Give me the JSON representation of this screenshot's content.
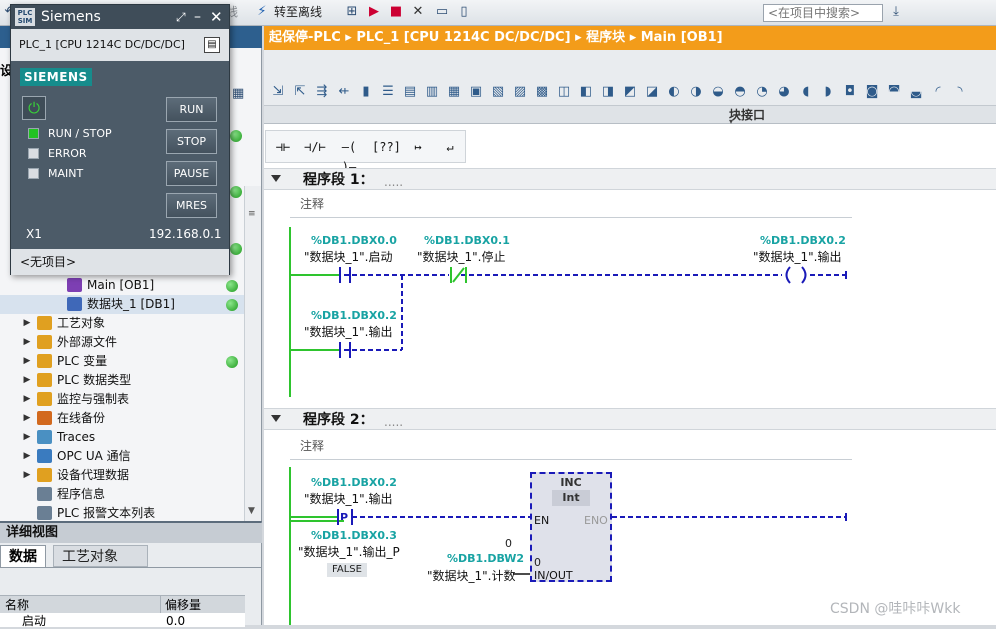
{
  "toolbar": {
    "go_online": "转至在线",
    "go_offline": "转至离线",
    "search_placeholder": "<在项目中搜索>"
  },
  "simulator": {
    "sim_badge_top": "PLC",
    "sim_badge_bottom": "SIM",
    "title": "Siemens",
    "subtitle": "PLC_1 [CPU 1214C DC/DC/DC]",
    "logo": "SIEMENS",
    "buttons": [
      "RUN",
      "STOP",
      "PAUSE",
      "MRES"
    ],
    "leds": [
      {
        "label": "RUN / STOP",
        "color": "#22c222"
      },
      {
        "label": "ERROR",
        "color": "#d9dde2"
      },
      {
        "label": "MAINT",
        "color": "#d9dde2"
      }
    ],
    "port": "X1",
    "ip": "192.168.0.1",
    "footer": "<无项目>"
  },
  "left_panel": {
    "head_partial": "设",
    "tree": [
      {
        "label": "Main [OB1]",
        "level": 3,
        "arrow": false,
        "icon_color": "#7d3fb3",
        "status": true,
        "selected": false
      },
      {
        "label": "数据块_1 [DB1]",
        "level": 3,
        "arrow": false,
        "icon_color": "#3f68b8",
        "status": true,
        "selected": true
      },
      {
        "label": "工艺对象",
        "level": 1,
        "arrow": true,
        "icon_color": "#e0a020",
        "status": false,
        "selected": false
      },
      {
        "label": "外部源文件",
        "level": 1,
        "arrow": true,
        "icon_color": "#e0a020",
        "status": false,
        "selected": false
      },
      {
        "label": "PLC 变量",
        "level": 1,
        "arrow": true,
        "icon_color": "#e0a020",
        "status": true,
        "selected": false
      },
      {
        "label": "PLC 数据类型",
        "level": 1,
        "arrow": true,
        "icon_color": "#e0a020",
        "status": false,
        "selected": false
      },
      {
        "label": "监控与强制表",
        "level": 1,
        "arrow": true,
        "icon_color": "#e0a020",
        "status": false,
        "selected": false
      },
      {
        "label": "在线备份",
        "level": 1,
        "arrow": true,
        "icon_color": "#d2691e",
        "status": false,
        "selected": false
      },
      {
        "label": "Traces",
        "level": 1,
        "arrow": true,
        "icon_color": "#4a90c2",
        "status": false,
        "selected": false
      },
      {
        "label": "OPC UA 通信",
        "level": 1,
        "arrow": true,
        "icon_color": "#3a7bbf",
        "status": false,
        "selected": false
      },
      {
        "label": "设备代理数据",
        "level": 1,
        "arrow": true,
        "icon_color": "#e0a020",
        "status": false,
        "selected": false
      },
      {
        "label": "程序信息",
        "level": 1,
        "arrow": false,
        "icon_color": "#6a7f94",
        "status": false,
        "selected": false
      },
      {
        "label": "PLC 报警文本列表",
        "level": 1,
        "arrow": false,
        "icon_color": "#6a7f94",
        "status": false,
        "selected": false
      }
    ]
  },
  "detail_view": {
    "title": "详细视图",
    "tabs": [
      "数据",
      "工艺对象"
    ],
    "columns": [
      "名称",
      "偏移量"
    ],
    "row": {
      "name": "启动",
      "offset": "0.0"
    }
  },
  "editor": {
    "breadcrumb": [
      "起保停-PLC",
      "PLC_1 [CPU 1214C DC/DC/DC]",
      "程序块",
      "Main [OB1]"
    ],
    "block_interface": "块接口",
    "ladder_elements": [
      "⊣⊢",
      "⊣/⊢",
      "–( )–",
      "[??]",
      "↦",
      "↵"
    ],
    "networks": [
      {
        "title": "程序段 1：",
        "dots": ".....",
        "comment": "注释",
        "vars": [
          {
            "addr": "%DB1.DBX0.0",
            "name": "\"数据块_1\".启动"
          },
          {
            "addr": "%DB1.DBX0.1",
            "name": "\"数据块_1\".停止"
          },
          {
            "addr": "%DB1.DBX0.2",
            "name": "\"数据块_1\".输出"
          },
          {
            "addr": "%DB1.DBX0.2",
            "name": "\"数据块_1\".输出"
          }
        ]
      },
      {
        "title": "程序段 2：",
        "dots": ".....",
        "comment": "注释",
        "vars": [
          {
            "addr": "%DB1.DBX0.2",
            "name": "\"数据块_1\".输出"
          },
          {
            "addr": "%DB1.DBX0.3",
            "name": "\"数据块_1\".输出_P"
          },
          {
            "addr": "%DB1.DBW2",
            "name": "\"数据块_1\".计数"
          }
        ],
        "p_label": "P",
        "false_badge": "FALSE",
        "dbw_value": "0",
        "inout_value": "0",
        "box": {
          "name": "INC",
          "type": "Int",
          "en": "EN",
          "eno": "ENO",
          "inout": "IN/OUT"
        }
      }
    ]
  },
  "watermark": "CSDN @哇咔咔Wkk",
  "colors": {
    "accent": "#f39c1a",
    "wire": "#1a1ab8",
    "rail": "#2ec42e",
    "addr": "#18a3a3"
  }
}
